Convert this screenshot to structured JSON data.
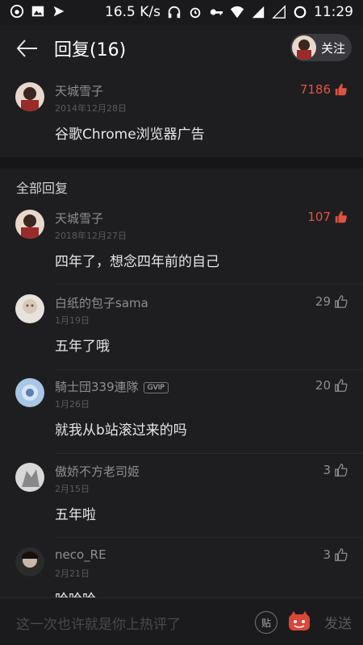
{
  "status_bar": {
    "net_speed": "16.5 K/s",
    "time": "11:29"
  },
  "header": {
    "title": "回复(16)",
    "follow_label": "关注"
  },
  "top_comment": {
    "name": "天城雪子",
    "date": "2014年12月28日",
    "likes": "7186",
    "content": "谷歌Chrome浏览器广告"
  },
  "section_title": "全部回复",
  "replies": [
    {
      "name": "天城雪子",
      "date": "2018年12月27日",
      "likes": "107",
      "content": "四年了，想念四年前的自己",
      "hot": true
    },
    {
      "name": "白纸的包子sama",
      "date": "1月19日",
      "likes": "29",
      "content": "五年了哦",
      "hot": false
    },
    {
      "name": "騎士団339連隊",
      "date": "1月26日",
      "likes": "20",
      "content": "就我从b站滚过来的吗",
      "hot": false,
      "badge": "GVIP"
    },
    {
      "name": "傲娇不方老司姬",
      "date": "2月15日",
      "likes": "3",
      "content": "五年啦",
      "hot": false
    },
    {
      "name": "neco_RE",
      "date": "2月21日",
      "likes": "3",
      "content": "哈哈哈",
      "hot": false
    }
  ],
  "input_bar": {
    "placeholder": "这一次也许就是你上热评了",
    "tie_label": "贴",
    "send_label": "发送"
  },
  "colors": {
    "background": "#1e1e20",
    "hot_like": "#e0533f",
    "muted": "#8e8e92"
  }
}
